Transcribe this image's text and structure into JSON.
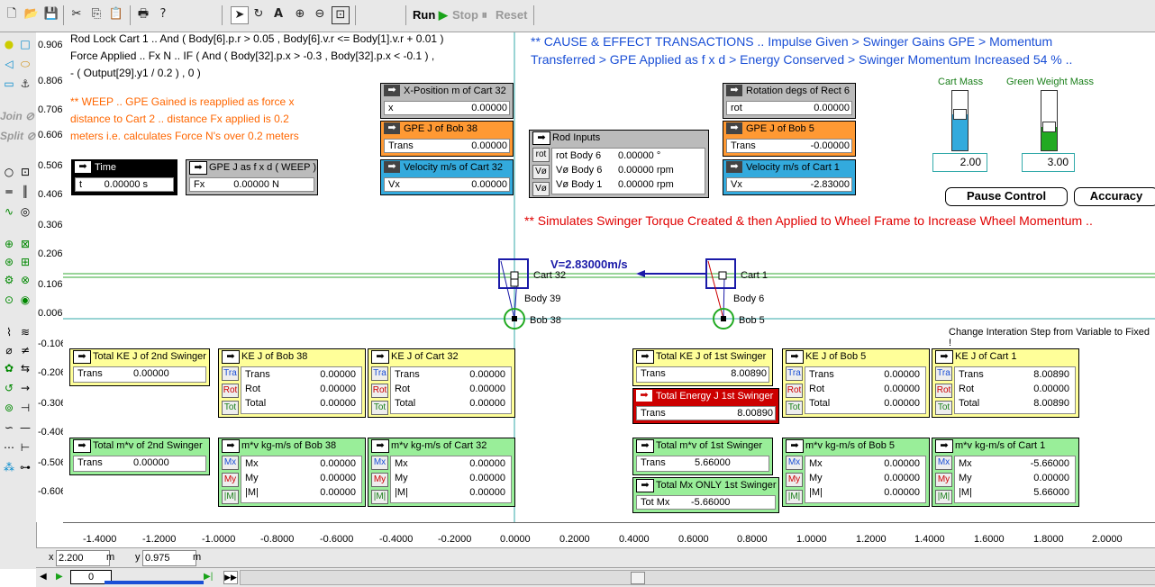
{
  "toolbar": {
    "run_label": "Run",
    "stop_label": "Stop",
    "reset_label": "Reset"
  },
  "sidebar": {
    "join_label": "Join",
    "split_label": "Split"
  },
  "yaxis_ticks": [
    "0.906",
    "0.806",
    "0.706",
    "0.606",
    "0.506",
    "0.406",
    "0.306",
    "0.206",
    "0.106",
    "0.006",
    "-0.106",
    "-0.206",
    "-0.306",
    "-0.406",
    "-0.506",
    "-0.606"
  ],
  "xaxis_ticks": [
    "-1.4000",
    "-1.2000",
    "-1.0000",
    "-0.8000",
    "-0.6000",
    "-0.4000",
    "-0.2000",
    "0.0000",
    "0.2000",
    "0.4000",
    "0.6000",
    "0.8000",
    "1.0000",
    "1.2000",
    "1.4000",
    "1.6000",
    "1.8000",
    "2.0000"
  ],
  "script": {
    "line1": "Rod Lock Cart 1 .. And ( Body[6].p.r > 0.05 , Body[6].v.r <= Body[1].v.r + 0.01 )",
    "line2": "Force Applied .. Fx N .. IF ( And ( Body[32].p.x > -0.3 , Body[32].p.x < -0.1 )  ,",
    "line3": "- ( Output[29].y1 / 0.2 )  , 0 )"
  },
  "weep_note": {
    "line1": "** WEEP .. GPE Gained is reapplied as force x",
    "line2": "distance to Cart 2 .. distance Fx applied is 0.2",
    "line3": "meters i.e. calculates Force N's over 0.2 meters"
  },
  "cause_effect": {
    "line1": "** CAUSE & EFFECT TRANSACTIONS .. Impulse Given > Swinger Gains GPE > Momentum",
    "line2": "Transferred > GPE Applied as f x d > Energy Conserved > Swinger Momentum Increased 54 % .."
  },
  "simulates_note": "** Simulates Swinger Torque Created & then Applied to Wheel Frame to Increase Wheel Momentum ..",
  "change_step_note": "Change Interation Step from Variable to Fixed !",
  "velocity_label": "V=2.83000m/s",
  "bodies": {
    "cart32": "Cart 32",
    "body39": "Body 39",
    "bob38": "Bob 38",
    "cart1": "Cart 1",
    "body6": "Body 6",
    "bob5": "Bob 5"
  },
  "sliders": {
    "cart_mass_label": "Cart Mass",
    "cart_mass_value": "2.00",
    "cart_mass_level": 0.6,
    "green_weight_label": "Green Weight Mass",
    "green_weight_value": "3.00",
    "green_weight_level": 0.4
  },
  "buttons": {
    "pause": "Pause Control",
    "accuracy": "Accuracy"
  },
  "meters": {
    "time": {
      "title": "Time",
      "label": "t",
      "value": "0.00000 s"
    },
    "gpe_fxd": {
      "title": "GPE J as f x d ( WEEP )",
      "label": "Fx",
      "value": "0.00000 N"
    },
    "xpos32": {
      "title": "X-Position m of Cart 32",
      "label": "x",
      "value": "0.00000"
    },
    "gpe38": {
      "title": "GPE J of Bob 38",
      "label": "Trans",
      "value": "0.00000"
    },
    "vel32": {
      "title": "Velocity m/s of Cart 32",
      "label": "Vx",
      "value": "0.00000"
    },
    "rod_inputs": {
      "title": "Rod Inputs",
      "tabs": [
        "rot",
        "Vø",
        "Vø"
      ],
      "rows": [
        {
          "label": "rot Body 6",
          "value": "0.00000 °"
        },
        {
          "label": "Vø Body 6",
          "value": "0.00000 rpm"
        },
        {
          "label": "Vø Body 1",
          "value": "0.00000 rpm"
        }
      ]
    },
    "rot6": {
      "title": "Rotation degs of Rect 6",
      "label": "rot",
      "value": "0.00000"
    },
    "gpe5": {
      "title": "GPE J of Bob 5",
      "label": "Trans",
      "value": "-0.00000"
    },
    "vel1": {
      "title": "Velocity m/s of Cart 1",
      "label": "Vx",
      "value": "-2.83000"
    },
    "totke2": {
      "title": "Total KE J of 2nd Swinger",
      "label": "Trans",
      "value": "0.00000"
    },
    "ke38": {
      "title": "KE J of Bob 38",
      "tabs": [
        "Tra",
        "Rot",
        "Tot"
      ],
      "rows": [
        {
          "label": "Trans",
          "value": "0.00000"
        },
        {
          "label": "Rot",
          "value": "0.00000"
        },
        {
          "label": "Total",
          "value": "0.00000"
        }
      ]
    },
    "ke32": {
      "title": "KE J of Cart 32",
      "tabs": [
        "Tra",
        "Rot",
        "Tot"
      ],
      "rows": [
        {
          "label": "Trans",
          "value": "0.00000"
        },
        {
          "label": "Rot",
          "value": "0.00000"
        },
        {
          "label": "Total",
          "value": "0.00000"
        }
      ]
    },
    "totke1": {
      "title": "Total KE J of 1st Swinger",
      "label": "Trans",
      "value": "8.00890"
    },
    "ke5": {
      "title": "KE J of Bob 5",
      "tabs": [
        "Tra",
        "Rot",
        "Tot"
      ],
      "rows": [
        {
          "label": "Trans",
          "value": "0.00000"
        },
        {
          "label": "Rot",
          "value": "0.00000"
        },
        {
          "label": "Total",
          "value": "0.00000"
        }
      ]
    },
    "ke1": {
      "title": "KE J of Cart 1",
      "tabs": [
        "Tra",
        "Rot",
        "Tot"
      ],
      "rows": [
        {
          "label": "Trans",
          "value": "8.00890"
        },
        {
          "label": "Rot",
          "value": "0.00000"
        },
        {
          "label": "Total",
          "value": "8.00890"
        }
      ]
    },
    "totenergy1": {
      "title": "Total Energy J 1st Swinger",
      "label": "Trans",
      "value": "8.00890"
    },
    "totmv2": {
      "title": "Total m*v of 2nd Swinger",
      "label": "Trans",
      "value": "0.00000"
    },
    "mv38": {
      "title": "m*v kg-m/s of Bob 38",
      "tabs": [
        "Mx",
        "My",
        "|M|"
      ],
      "rows": [
        {
          "label": "Mx",
          "value": "0.00000"
        },
        {
          "label": "My",
          "value": "0.00000"
        },
        {
          "label": "|M|",
          "value": "0.00000"
        }
      ]
    },
    "mv32": {
      "title": "m*v kg-m/s of Cart 32",
      "tabs": [
        "Mx",
        "My",
        "|M|"
      ],
      "rows": [
        {
          "label": "Mx",
          "value": "0.00000"
        },
        {
          "label": "My",
          "value": "0.00000"
        },
        {
          "label": "|M|",
          "value": "0.00000"
        }
      ]
    },
    "totmv1": {
      "title": "Total m*v of 1st Swinger",
      "label": "Trans",
      "value": "5.66000"
    },
    "mv5": {
      "title": "m*v kg-m/s of Bob 5",
      "tabs": [
        "Mx",
        "My",
        "|M|"
      ],
      "rows": [
        {
          "label": "Mx",
          "value": "0.00000"
        },
        {
          "label": "My",
          "value": "0.00000"
        },
        {
          "label": "|M|",
          "value": "0.00000"
        }
      ]
    },
    "mv1": {
      "title": "m*v kg-m/s of Cart 1",
      "tabs": [
        "Mx",
        "My",
        "|M|"
      ],
      "rows": [
        {
          "label": "Mx",
          "value": "-5.66000"
        },
        {
          "label": "My",
          "value": "0.00000"
        },
        {
          "label": "|M|",
          "value": "5.66000"
        }
      ]
    },
    "totmx1": {
      "title": "Total Mx ONLY 1st Swinger",
      "label": "Tot Mx",
      "value": "-5.66000"
    }
  },
  "status": {
    "x_label": "x",
    "x_value": "2.200",
    "x_unit": "m",
    "y_label": "y",
    "y_value": "0.975",
    "y_unit": "m",
    "frame_value": "0"
  }
}
